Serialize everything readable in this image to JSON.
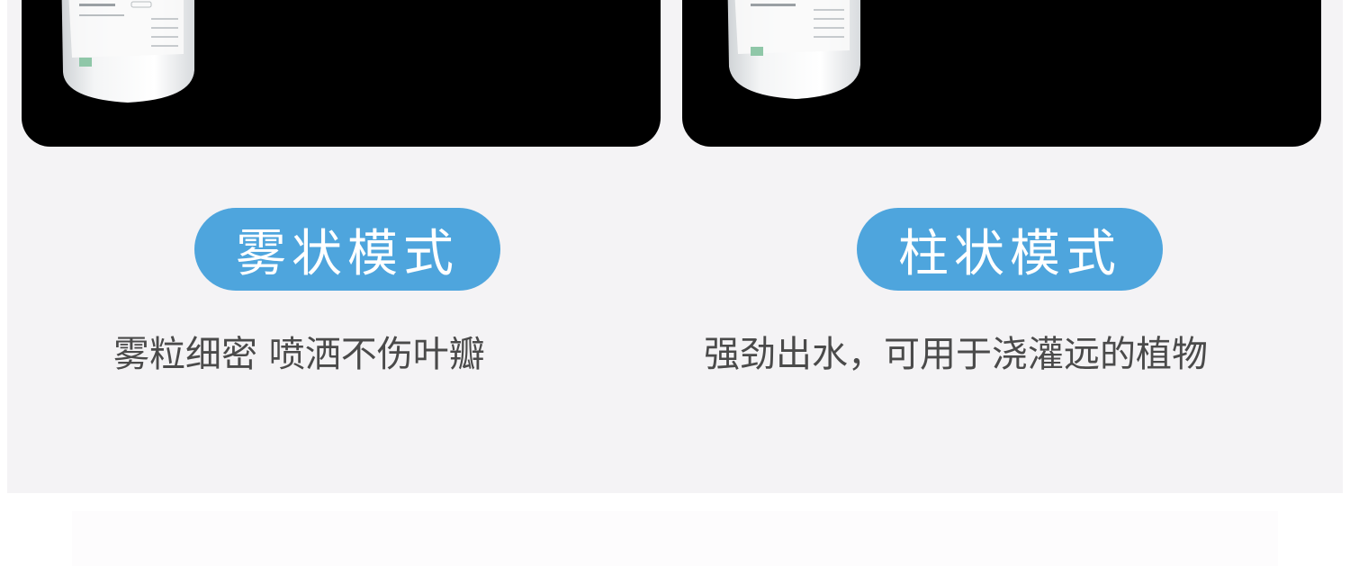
{
  "modes": [
    {
      "title": "雾状模式",
      "description": "雾粒细密 喷洒不伤叶瓣"
    },
    {
      "title": "柱状模式",
      "description": "强劲出水，可用于浇灌远的植物"
    }
  ],
  "colors": {
    "pill": "#4ea5dd",
    "panel": "#f4f3f5",
    "photo_background": "#000000",
    "description_text": "#4a4a4a"
  }
}
